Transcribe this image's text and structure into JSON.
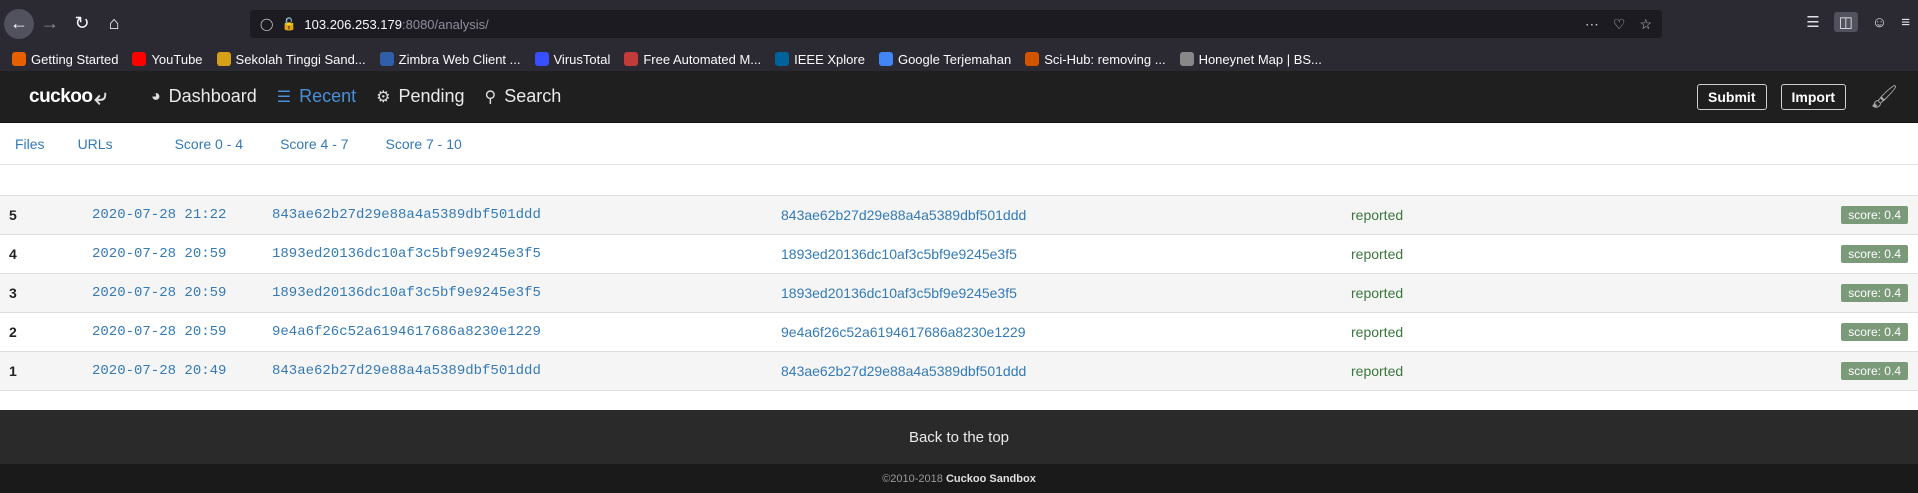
{
  "browser": {
    "url_host": "103.206.253.179",
    "url_rest": ":8080/analysis/",
    "bookmarks": [
      {
        "label": "Getting Started",
        "color": "#e66000"
      },
      {
        "label": "YouTube",
        "color": "#ff0000"
      },
      {
        "label": "Sekolah Tinggi Sand...",
        "color": "#d4a017"
      },
      {
        "label": "Zimbra Web Client ...",
        "color": "#2f5fa8"
      },
      {
        "label": "VirusTotal",
        "color": "#394eff"
      },
      {
        "label": "Free Automated M...",
        "color": "#c23b3b"
      },
      {
        "label": "IEEE Xplore",
        "color": "#00629b"
      },
      {
        "label": "Google Terjemahan",
        "color": "#4285f4"
      },
      {
        "label": "Sci-Hub: removing ...",
        "color": "#d35400"
      },
      {
        "label": "Honeynet Map | BS...",
        "color": "#888888"
      }
    ]
  },
  "app": {
    "logo": "cuckoo",
    "nav": [
      {
        "label": "Dashboard",
        "icon": "dashboard-icon"
      },
      {
        "label": "Recent",
        "icon": "list-icon"
      },
      {
        "label": "Pending",
        "icon": "gears-icon"
      },
      {
        "label": "Search",
        "icon": "search-icon"
      }
    ],
    "submit_label": "Submit",
    "import_label": "Import"
  },
  "filters": [
    "Files",
    "URLs",
    "Score 0 - 4",
    "Score 4 - 7",
    "Score 7 - 10"
  ],
  "rows": [
    {
      "id": "5",
      "date": "2020-07-28 21:22",
      "md5": "843ae62b27d29e88a4a5389dbf501ddd",
      "target": "843ae62b27d29e88a4a5389dbf501ddd",
      "status": "reported",
      "score": "score: 0.4"
    },
    {
      "id": "4",
      "date": "2020-07-28 20:59",
      "md5": "1893ed20136dc10af3c5bf9e9245e3f5",
      "target": "1893ed20136dc10af3c5bf9e9245e3f5",
      "status": "reported",
      "score": "score: 0.4"
    },
    {
      "id": "3",
      "date": "2020-07-28 20:59",
      "md5": "1893ed20136dc10af3c5bf9e9245e3f5",
      "target": "1893ed20136dc10af3c5bf9e9245e3f5",
      "status": "reported",
      "score": "score: 0.4"
    },
    {
      "id": "2",
      "date": "2020-07-28 20:59",
      "md5": "9e4a6f26c52a6194617686a8230e1229",
      "target": "9e4a6f26c52a6194617686a8230e1229",
      "status": "reported",
      "score": "score: 0.4"
    },
    {
      "id": "1",
      "date": "2020-07-28 20:49",
      "md5": "843ae62b27d29e88a4a5389dbf501ddd",
      "target": "843ae62b27d29e88a4a5389dbf501ddd",
      "status": "reported",
      "score": "score: 0.4"
    }
  ],
  "footer": {
    "back_to_top": "Back to the top",
    "copyright": "©2010-2018",
    "brand": "Cuckoo Sandbox"
  }
}
